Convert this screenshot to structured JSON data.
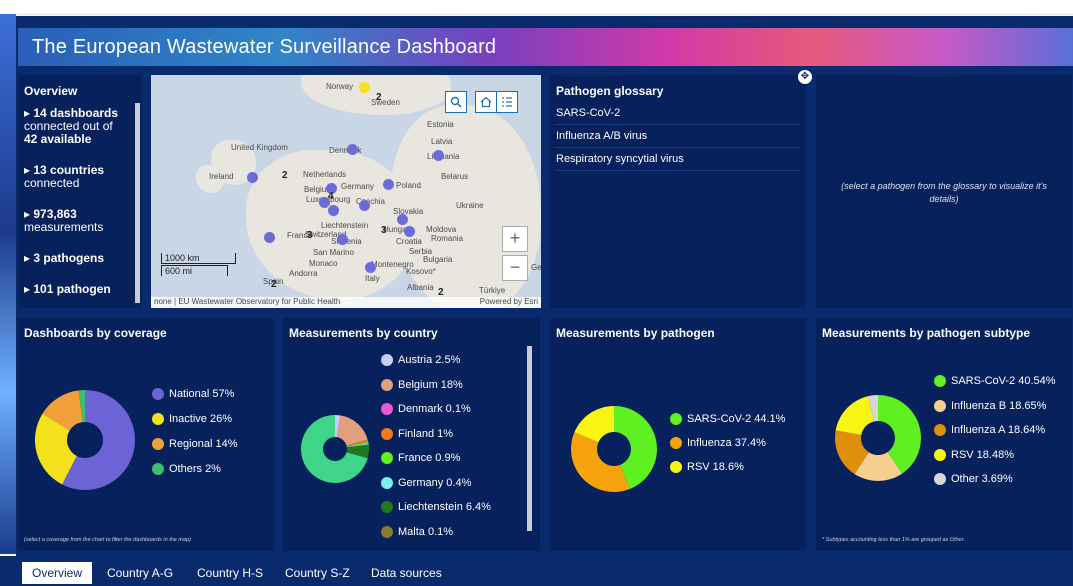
{
  "title": "The European Wastewater Surveillance Dashboard",
  "overview": {
    "heading": "Overview",
    "items": [
      {
        "bold": "14 dashboards",
        "rest": "connected out of",
        "bold2": "42 available"
      },
      {
        "bold": "13 countries",
        "rest": "connected",
        "bold2": ""
      },
      {
        "bold": "973,863",
        "rest": "measurements",
        "bold2": ""
      },
      {
        "bold": "3 pathogens",
        "rest": "",
        "bold2": ""
      },
      {
        "bold": "101 pathogen",
        "rest": "",
        "bold2": ""
      }
    ]
  },
  "map": {
    "labels": [
      "Norway",
      "Sweden",
      "Estonia",
      "Latvia",
      "United Kingdom",
      "Denmark",
      "Lithuania",
      "Ireland",
      "Netherlands",
      "Belgium",
      "Germany",
      "Poland",
      "Belarus",
      "Luxembourg",
      "Czechia",
      "Slovakia",
      "Ukraine",
      "Liechtenstein",
      "France",
      "Switzerland",
      "Hungary",
      "Moldova",
      "Slovenia",
      "Croatia",
      "Romania",
      "San Marino",
      "Serbia",
      "Monaco",
      "Montenegro",
      "Bulgaria",
      "Andorra",
      "Italy",
      "Kosovo*",
      "Spain",
      "Albania",
      "Türkiye",
      "Ge"
    ],
    "cluster_numbers": [
      "2",
      "2",
      "4",
      "3",
      "3",
      "2",
      "2"
    ],
    "scale": [
      "1000 km",
      "600 mi"
    ],
    "attribution": "none | EU Wastewater Observatory for Public Health",
    "powered_by": "Powered by Esri",
    "zoom_in": "+",
    "zoom_out": "−"
  },
  "glossary": {
    "heading": "Pathogen glossary",
    "items": [
      "SARS-CoV-2",
      "Influenza A/B virus",
      "Respiratory syncytial virus"
    ]
  },
  "detail_placeholder": "(select a pathogen from the glossary to visualize it's details)",
  "coverage": {
    "heading": "Dashboards by coverage",
    "footnote": "(select a coverage from the chart to filter the dashboards in the map)",
    "legend": [
      {
        "label": "National 57%",
        "color": "#6b63d6"
      },
      {
        "label": "Inactive 26%",
        "color": "#f3e21b"
      },
      {
        "label": "Regional 14%",
        "color": "#f2a03a"
      },
      {
        "label": "Others 2%",
        "color": "#3fbf6a"
      }
    ]
  },
  "by_country": {
    "heading": "Measurements by country",
    "legend": [
      {
        "label": "Austria 2.5%",
        "color": "#c9cdf7"
      },
      {
        "label": "Belgium 18%",
        "color": "#e3a07e"
      },
      {
        "label": "Denmark 0.1%",
        "color": "#ea5ad6"
      },
      {
        "label": "Finland 1%",
        "color": "#f47a17"
      },
      {
        "label": "France 0.9%",
        "color": "#5ef021"
      },
      {
        "label": "Germany 0.4%",
        "color": "#7ef0f0"
      },
      {
        "label": "Liechtenstein 6.4%",
        "color": "#1f7a1f"
      },
      {
        "label": "Malta 0.1%",
        "color": "#8a7a2c"
      }
    ]
  },
  "by_pathogen": {
    "heading": "Measurements by pathogen",
    "legend": [
      {
        "label": "SARS-CoV-2 44.1%",
        "color": "#5ef021"
      },
      {
        "label": "Influenza 37.4%",
        "color": "#f5a20b"
      },
      {
        "label": "RSV 18.6%",
        "color": "#f8f514"
      }
    ]
  },
  "by_subtype": {
    "heading": "Measurements by pathogen subtype",
    "footnote": "* Subtypes accounting less than 1% are grouped as Other.",
    "legend": [
      {
        "label": "SARS-CoV-2 40.54%",
        "color": "#5ef021"
      },
      {
        "label": "Influenza B 18.65%",
        "color": "#f6cf8e"
      },
      {
        "label": "Influenza A 18.64%",
        "color": "#e08f0a"
      },
      {
        "label": "RSV 18.48%",
        "color": "#f8f514"
      },
      {
        "label": "Other 3.69%",
        "color": "#d6d6d6"
      }
    ]
  },
  "tabs": [
    "Overview",
    "Country A-G",
    "Country H-S",
    "Country S-Z",
    "Data sources"
  ]
}
